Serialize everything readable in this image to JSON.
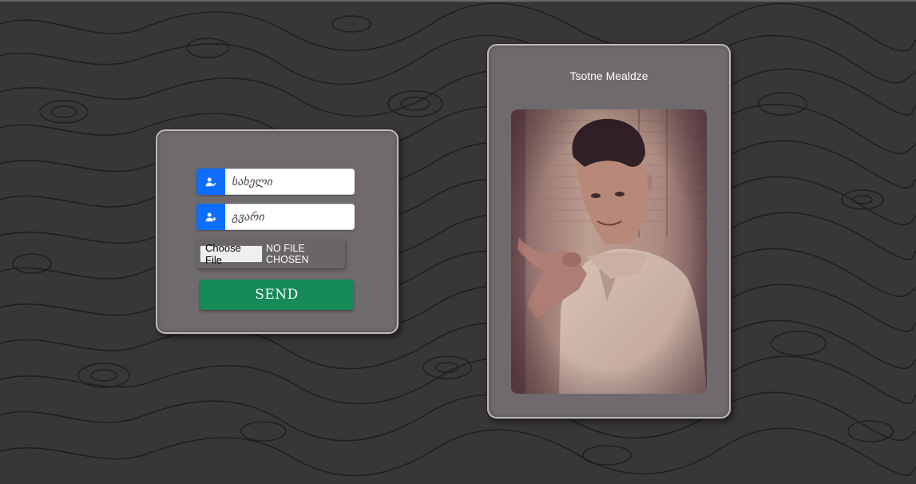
{
  "form": {
    "first_name": {
      "placeholder": "სახელი",
      "value": "",
      "icon": "person-check-icon"
    },
    "last_name": {
      "placeholder": "გვარი",
      "value": "",
      "icon": "person-plus-icon"
    },
    "file": {
      "button_label": "Choose File",
      "status_text": "NO FILE CHOSEN"
    },
    "send_label": "SEND"
  },
  "profile": {
    "name": "Tsotne Mealdze",
    "photo": "portrait-photo"
  },
  "colors": {
    "background": "#383634",
    "card": "#6f6a6e",
    "accent_blue": "#0d6efd",
    "send_green": "#168a57",
    "photo_tone": "#b89a8a"
  }
}
